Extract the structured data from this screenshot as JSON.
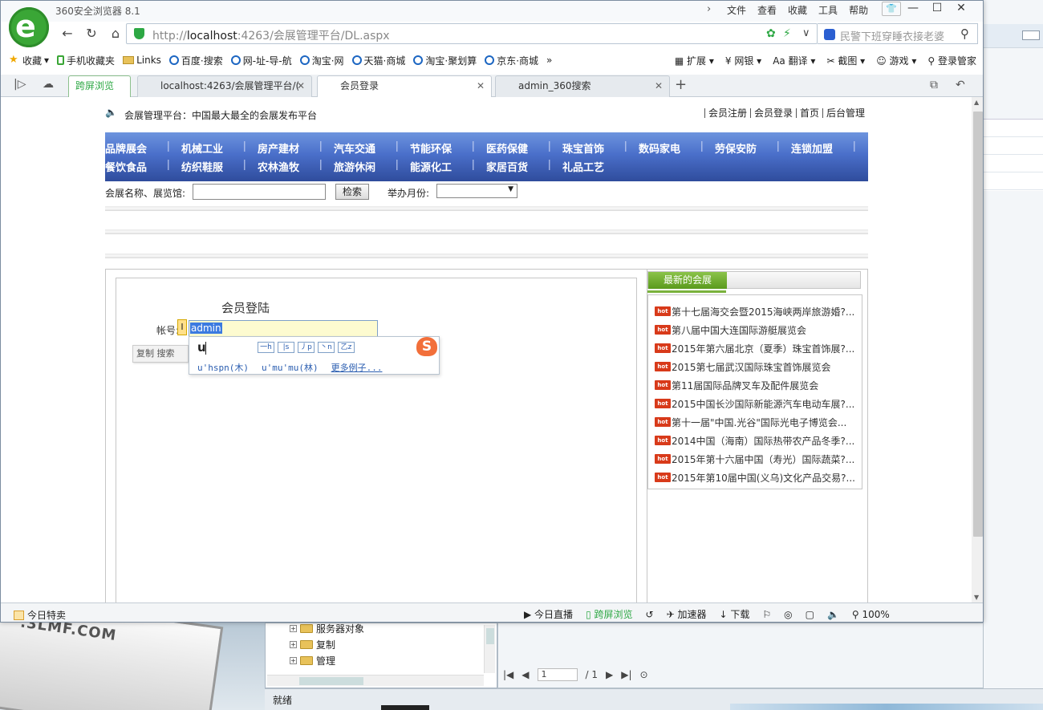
{
  "app_title": "360安全浏览器 8.1",
  "menu": [
    "文件",
    "查看",
    "收藏",
    "工具",
    "帮助"
  ],
  "address": {
    "url_host_prefix": "http://",
    "url_host": "localhost",
    "url_rest": ":4263/会展管理平台/DL.aspx",
    "search_placeholder": "民警下班穿睡衣接老婆"
  },
  "favorites": [
    "收藏",
    "手机收藏夹",
    "Links",
    "百度·搜索",
    "网-址-导-航",
    "淘宝·网",
    "天猫·商城",
    "淘宝·聚划算",
    "京东·商城"
  ],
  "favorites_right": [
    "扩展",
    "网银",
    "翻译",
    "截图",
    "游戏",
    "登录管家"
  ],
  "tabs": [
    {
      "label": "跨屏浏览"
    },
    {
      "label": "localhost:4263/会展管理平台/("
    },
    {
      "label": "会员登录"
    },
    {
      "label": "admin_360搜索"
    }
  ],
  "site": {
    "slogan": "会展管理平台：中国最大最全的会展发布平台",
    "top_links": [
      "会员注册",
      "会员登录",
      "首页",
      "后台管理"
    ],
    "nav_row1": [
      "品牌展会",
      "机械工业",
      "房产建材",
      "汽车交通",
      "节能环保",
      "医药保健",
      "珠宝首饰",
      "数码家电",
      "劳保安防",
      "连锁加盟"
    ],
    "nav_row2": [
      "餐饮食品",
      "纺织鞋服",
      "农林渔牧",
      "旅游休闲",
      "能源化工",
      "家居百货",
      "礼品工艺"
    ],
    "search_label": "会展名称、展览馆:",
    "search_button": "检索",
    "month_label": "举办月份:",
    "month_value": ""
  },
  "login": {
    "title": "会员登陆",
    "account_label": "帐号:",
    "account_value": "admin",
    "context_items": [
      "复制",
      "搜索"
    ]
  },
  "ime": {
    "composition": "u",
    "strokes": [
      "一h",
      "|s",
      "丿p",
      "丶n",
      "乙z"
    ],
    "candidates": [
      "u'hspn(木)",
      "u'mu'mu(林)",
      "更多例子..."
    ]
  },
  "sidebar": {
    "tab_label": "最新的会展",
    "hot_badge": "hot",
    "items": [
      "第十七届海交会暨2015海峡两岸旅游婚?...",
      "第八届中国大连国际游艇展览会",
      "2015年第六届北京（夏季）珠宝首饰展?...",
      "2015第七届武汉国际珠宝首饰展览会",
      "第11届国际品牌叉车及配件展览会",
      "2015中国长沙国际新能源汽车电动车展?...",
      "第十一届\"中国.光谷\"国际光电子博览会...",
      "2014中国（海南）国际热带农产品冬季?...",
      "2015年第十六届中国（寿光）国际蔬菜?...",
      "2015年第10届中国(义乌)文化产品交易?..."
    ]
  },
  "status": {
    "left": "今日特卖",
    "right": [
      "今日直播",
      "跨屏浏览",
      "加速器",
      "下载",
      "100%"
    ]
  },
  "background": {
    "tree_items": [
      "服务器对象",
      "复制",
      "管理"
    ],
    "pager_page": "1",
    "pager_total": "/ 1",
    "status_text": "就绪",
    "billboard": ".3LMF.COM"
  }
}
